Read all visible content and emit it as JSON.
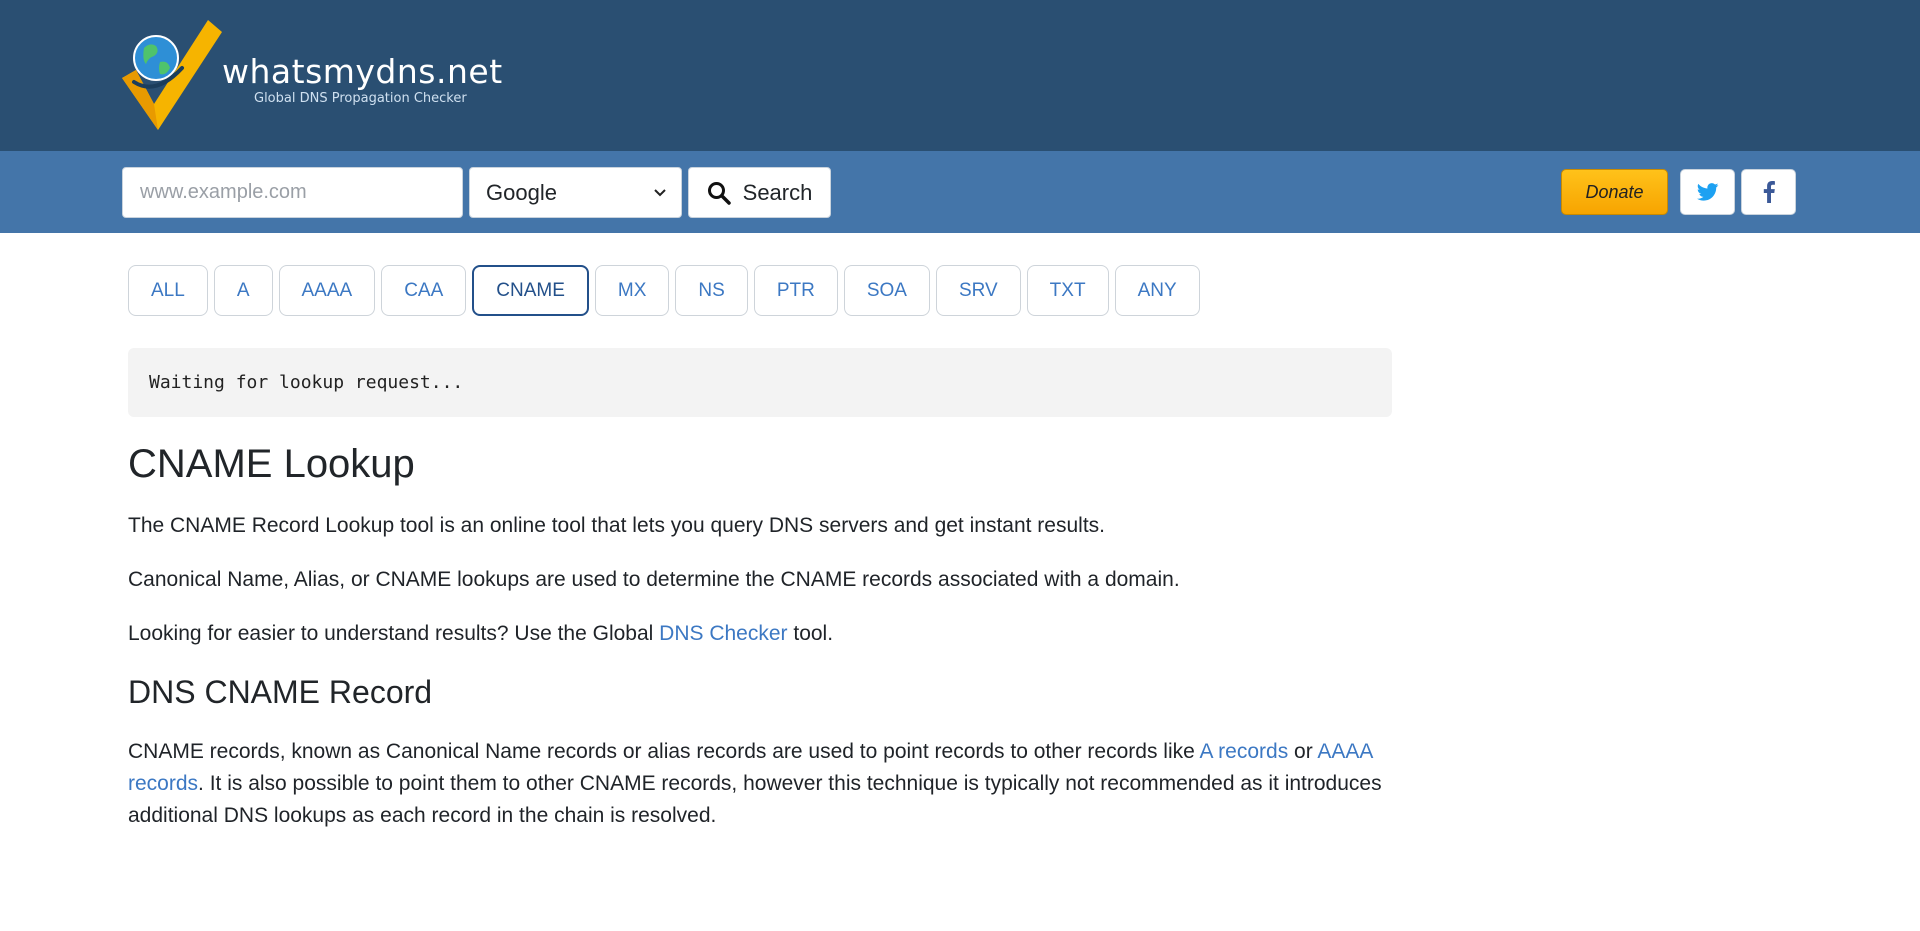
{
  "header": {
    "site_name": "whatsmydns.net",
    "tagline": "Global DNS Propagation Checker",
    "logo_icon": "globe-checkmark-logo"
  },
  "toolbar": {
    "search_placeholder": "www.example.com",
    "search_value": "",
    "resolver_selected": "Google",
    "search_label": "Search",
    "donate_label": "Donate",
    "social": [
      "twitter-icon",
      "facebook-icon"
    ]
  },
  "tabs": [
    {
      "label": "ALL",
      "active": false
    },
    {
      "label": "A",
      "active": false
    },
    {
      "label": "AAAA",
      "active": false
    },
    {
      "label": "CAA",
      "active": false
    },
    {
      "label": "CNAME",
      "active": true
    },
    {
      "label": "MX",
      "active": false
    },
    {
      "label": "NS",
      "active": false
    },
    {
      "label": "PTR",
      "active": false
    },
    {
      "label": "SOA",
      "active": false
    },
    {
      "label": "SRV",
      "active": false
    },
    {
      "label": "TXT",
      "active": false
    },
    {
      "label": "ANY",
      "active": false
    }
  ],
  "status": {
    "text": "Waiting for lookup request..."
  },
  "content": {
    "title": "CNAME Lookup",
    "intro": "The CNAME Record Lookup tool is an online tool that lets you query DNS servers and get instant results.",
    "description": "Canonical Name, Alias, or CNAME lookups are used to determine the CNAME records associated with a domain.",
    "checker_prefix": "Looking for easier to understand results? Use the Global ",
    "checker_link": "DNS Checker",
    "checker_suffix": " tool.",
    "section_title": "DNS CNAME Record",
    "record_text_1": "CNAME records, known as Canonical Name records or alias records are used to point records to other records like ",
    "a_records_link": "A records",
    "record_text_2": " or ",
    "aaaa_records_link": "AAAA records",
    "record_text_3": ". It is also possible to point them to other CNAME records, however this technique is typically not recommended as it introduces additional DNS lookups as each record in the chain is resolved."
  },
  "colors": {
    "header_bg": "#2a4f72",
    "toolbar_bg": "#4475a9",
    "link": "#3c78c3",
    "active_tab": "#23508a",
    "donate": "#ffb300"
  }
}
